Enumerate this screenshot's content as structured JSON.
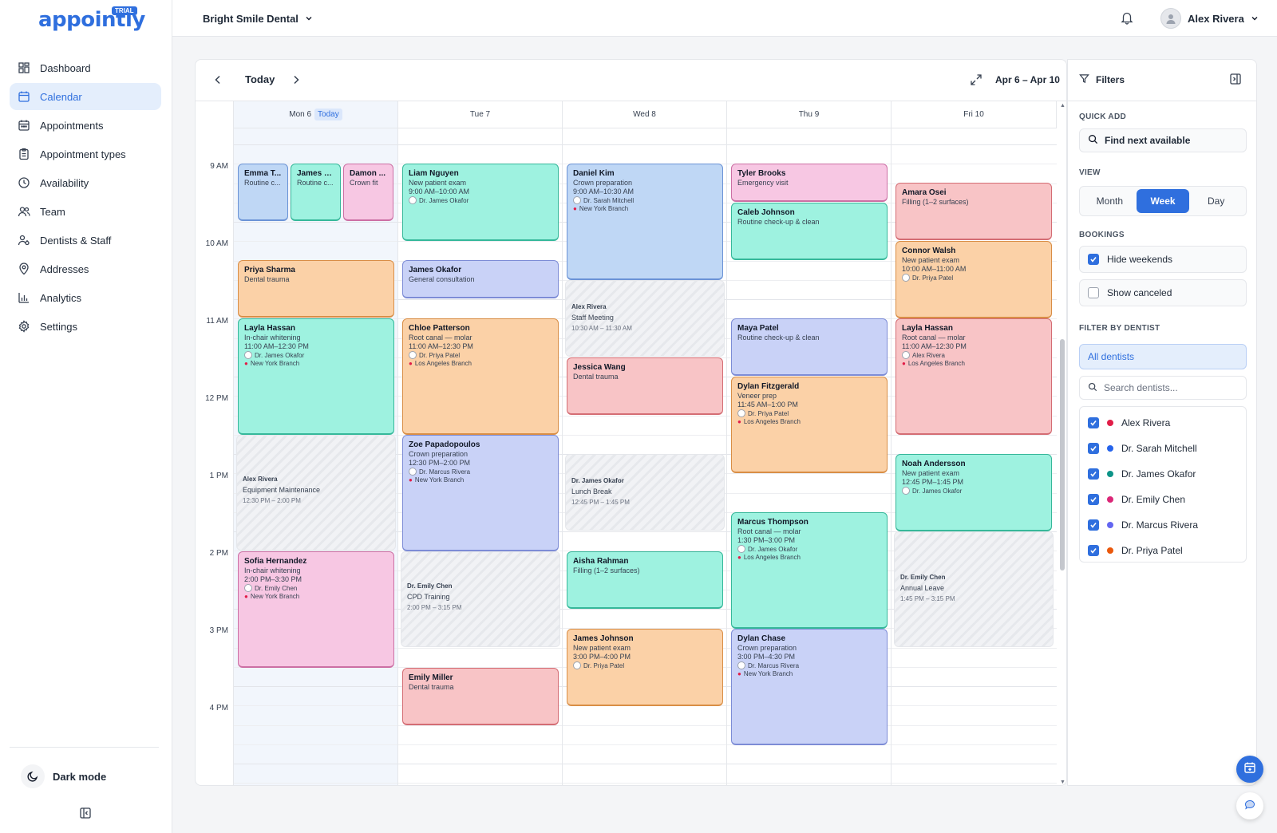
{
  "app": {
    "logo": "appointly",
    "badge": "TRIAL"
  },
  "header": {
    "clinic": "Bright Smile Dental",
    "user_name": "Alex Rivera"
  },
  "sidebar": {
    "items": [
      {
        "label": "Dashboard",
        "icon": "dashboard-icon"
      },
      {
        "label": "Calendar",
        "icon": "calendar-icon",
        "active": true
      },
      {
        "label": "Appointments",
        "icon": "appointments-icon"
      },
      {
        "label": "Appointment types",
        "icon": "clipboard-icon"
      },
      {
        "label": "Availability",
        "icon": "clock-icon"
      },
      {
        "label": "Team",
        "icon": "team-icon"
      },
      {
        "label": "Dentists & Staff",
        "icon": "staff-icon"
      },
      {
        "label": "Addresses",
        "icon": "pin-icon"
      },
      {
        "label": "Analytics",
        "icon": "analytics-icon"
      },
      {
        "label": "Settings",
        "icon": "gear-icon"
      }
    ],
    "dark_mode_label": "Dark mode"
  },
  "toolbar": {
    "today_label": "Today",
    "range": "Apr 6 – Apr 10"
  },
  "times": [
    "9 AM",
    "10 AM",
    "11 AM",
    "12 PM",
    "1 PM",
    "2 PM",
    "3 PM",
    "4 PM"
  ],
  "days": [
    {
      "label": "Mon 6",
      "badge": "Today"
    },
    {
      "label": "Tue 7"
    },
    {
      "label": "Wed 8"
    },
    {
      "label": "Thu 9"
    },
    {
      "label": "Fri 10"
    }
  ],
  "events": {
    "mon": [
      {
        "name": "Emma T...",
        "sub": "Routine c..."
      },
      {
        "name": "James B...",
        "sub": "Routine c..."
      },
      {
        "name": "Damon ...",
        "sub": "Crown fit"
      },
      {
        "name": "Priya Sharma",
        "sub": "Dental trauma"
      },
      {
        "name": "Layla Hassan",
        "sub": "In-chair whitening",
        "time": "11:00 AM–12:30 PM",
        "doctor": "Dr. James Okafor",
        "branch": "New York Branch"
      },
      {
        "block": true,
        "who": "Alex Rivera",
        "title": "Equipment Maintenance",
        "time": "12:30 PM – 2:00 PM"
      },
      {
        "name": "Sofia Hernandez",
        "sub": "In-chair whitening",
        "time": "2:00 PM–3:30 PM",
        "doctor": "Dr. Emily Chen",
        "branch": "New York Branch"
      }
    ],
    "tue": [
      {
        "name": "Liam Nguyen",
        "sub": "New patient exam",
        "time": "9:00 AM–10:00 AM",
        "doctor": "Dr. James Okafor"
      },
      {
        "name": "James Okafor",
        "sub": "General consultation"
      },
      {
        "name": "Chloe Patterson",
        "sub": "Root canal — molar",
        "time": "11:00 AM–12:30 PM",
        "doctor": "Dr. Priya Patel",
        "branch": "Los Angeles Branch"
      },
      {
        "name": "Zoe Papadopoulos",
        "sub": "Crown preparation",
        "time": "12:30 PM–2:00 PM",
        "doctor": "Dr. Marcus Rivera",
        "branch": "New York Branch"
      },
      {
        "block": true,
        "who": "Dr. Emily Chen",
        "title": "CPD Training",
        "time": "2:00 PM – 3:15 PM"
      },
      {
        "name": "Emily Miller",
        "sub": "Dental trauma"
      }
    ],
    "wed": [
      {
        "name": "Daniel Kim",
        "sub": "Crown preparation",
        "time": "9:00 AM–10:30 AM",
        "doctor": "Dr. Sarah Mitchell",
        "branch": "New York Branch"
      },
      {
        "block": true,
        "who": "Alex Rivera",
        "title": "Staff Meeting",
        "time": "10:30 AM – 11:30 AM"
      },
      {
        "name": "Jessica Wang",
        "sub": "Dental trauma"
      },
      {
        "block": true,
        "who": "Dr. James Okafor",
        "title": "Lunch Break",
        "time": "12:45 PM – 1:45 PM"
      },
      {
        "name": "Aisha Rahman",
        "sub": "Filling (1–2 surfaces)"
      },
      {
        "name": "James Johnson",
        "sub": "New patient exam",
        "time": "3:00 PM–4:00 PM",
        "doctor": "Dr. Priya Patel"
      }
    ],
    "thu": [
      {
        "name": "Tyler Brooks",
        "sub": "Emergency visit"
      },
      {
        "name": "Caleb Johnson",
        "sub": "Routine check-up & clean"
      },
      {
        "name": "Maya Patel",
        "sub": "Routine check-up & clean"
      },
      {
        "name": "Dylan Fitzgerald",
        "sub": "Veneer prep",
        "time": "11:45 AM–1:00 PM",
        "doctor": "Dr. Priya Patel",
        "branch": "Los Angeles Branch"
      },
      {
        "name": "Marcus Thompson",
        "sub": "Root canal — molar",
        "time": "1:30 PM–3:00 PM",
        "doctor": "Dr. James Okafor",
        "branch": "Los Angeles Branch"
      },
      {
        "name": "Dylan Chase",
        "sub": "Crown preparation",
        "time": "3:00 PM–4:30 PM",
        "doctor": "Dr. Marcus Rivera",
        "branch": "New York Branch"
      }
    ],
    "fri": [
      {
        "name": "Amara Osei",
        "sub": "Filling (1–2 surfaces)"
      },
      {
        "name": "Connor Walsh",
        "sub": "New patient exam",
        "time": "10:00 AM–11:00 AM",
        "doctor": "Dr. Priya Patel"
      },
      {
        "name": "Layla Hassan",
        "sub": "Root canal — molar",
        "time": "11:00 AM–12:30 PM",
        "doctor": "Alex Rivera",
        "branch": "Los Angeles Branch"
      },
      {
        "name": "Noah Andersson",
        "sub": "New patient exam",
        "time": "12:45 PM–1:45 PM",
        "doctor": "Dr. James Okafor"
      },
      {
        "block": true,
        "who": "Dr. Emily Chen",
        "title": "Annual Leave",
        "time": "1:45 PM – 3:15 PM"
      }
    ]
  },
  "filters": {
    "title": "Filters",
    "quick_add_label": "QUICK ADD",
    "find_next": "Find next available",
    "view_label": "VIEW",
    "views": [
      "Month",
      "Week",
      "Day"
    ],
    "active_view": "Week",
    "bookings_label": "BOOKINGS",
    "hide_weekends": "Hide weekends",
    "show_canceled": "Show canceled",
    "by_dentist_label": "FILTER BY DENTIST",
    "all_dentists": "All dentists",
    "search_placeholder": "Search dentists...",
    "dentists": [
      {
        "name": "Alex Rivera",
        "color": "#e11d48"
      },
      {
        "name": "Dr. Sarah Mitchell",
        "color": "#2563eb"
      },
      {
        "name": "Dr. James Okafor",
        "color": "#0d9488"
      },
      {
        "name": "Dr. Emily Chen",
        "color": "#db2777"
      },
      {
        "name": "Dr. Marcus Rivera",
        "color": "#6366f1"
      },
      {
        "name": "Dr. Priya Patel",
        "color": "#ea580c"
      }
    ]
  },
  "colors": {
    "accent": "#2f6fde"
  }
}
